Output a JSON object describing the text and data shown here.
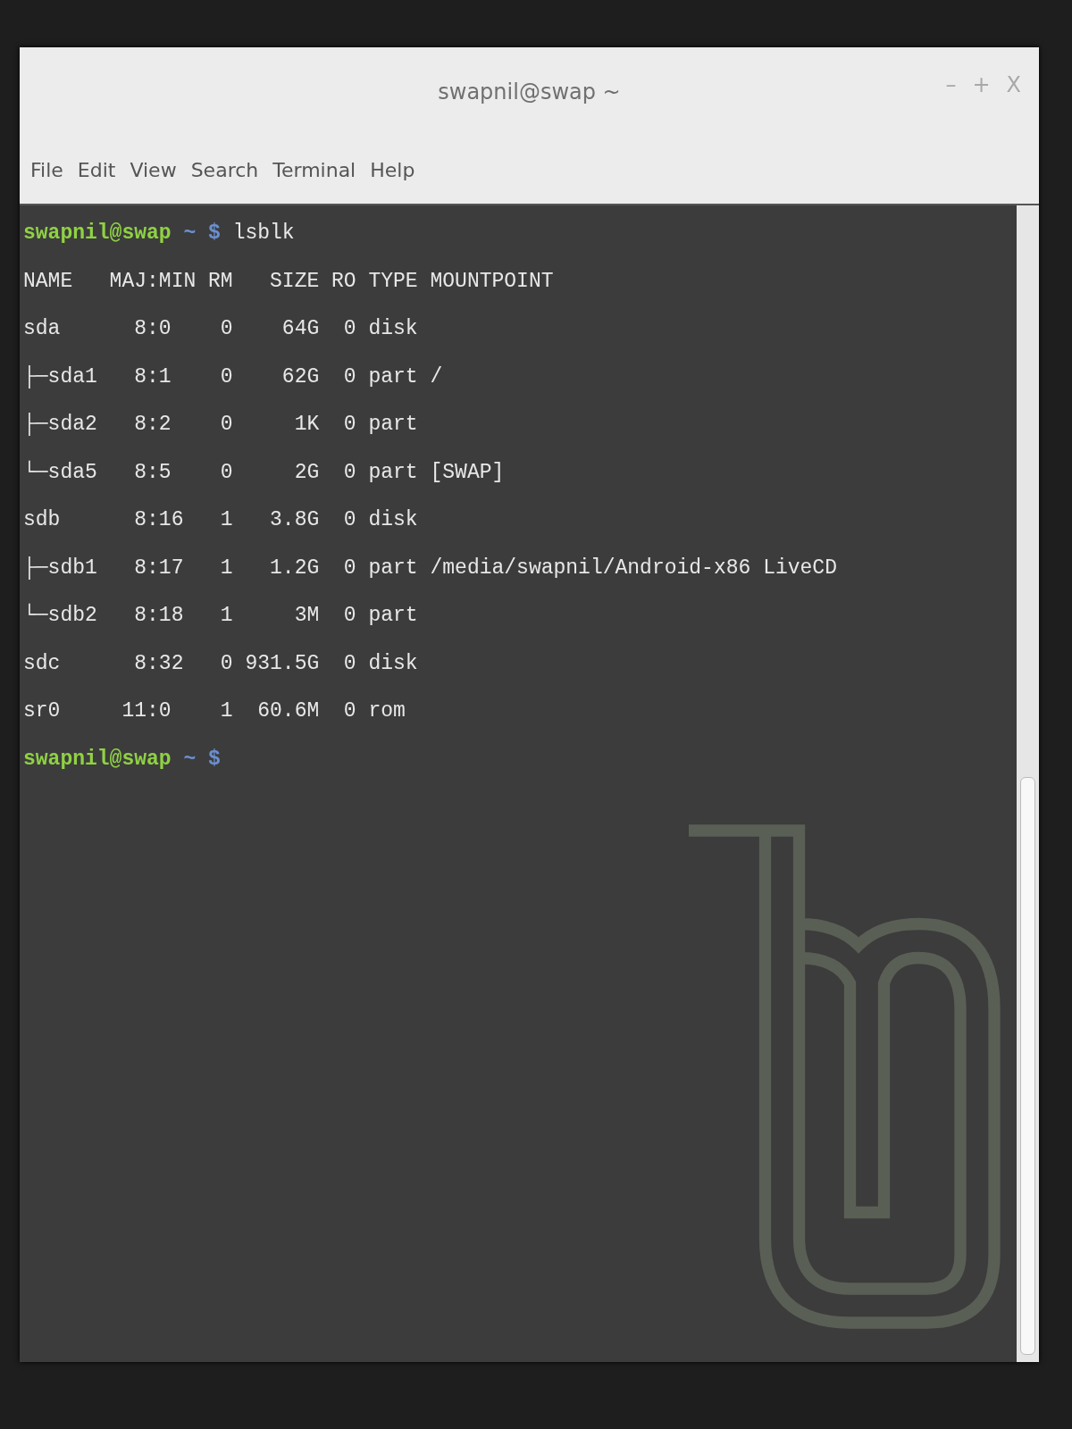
{
  "window": {
    "title": "swapnil@swap ~",
    "controls": [
      "–",
      "+",
      "X"
    ]
  },
  "menu": [
    "File",
    "Edit",
    "View",
    "Search",
    "Terminal",
    "Help"
  ],
  "terminal": {
    "lines": [
      {
        "kind": "prompt",
        "user_host": "swapnil@swap",
        "path": "~",
        "symbol": "$",
        "command": "lsblk"
      },
      {
        "kind": "output",
        "text": "NAME   MAJ:MIN RM   SIZE RO TYPE MOUNTPOINT"
      },
      {
        "kind": "output",
        "text": "sda      8:0    0    64G  0 disk"
      },
      {
        "kind": "output",
        "text": "├─sda1   8:1    0    62G  0 part /"
      },
      {
        "kind": "output",
        "text": "├─sda2   8:2    0     1K  0 part"
      },
      {
        "kind": "output",
        "text": "└─sda5   8:5    0     2G  0 part [SWAP]"
      },
      {
        "kind": "output",
        "text": "sdb      8:16   1   3.8G  0 disk"
      },
      {
        "kind": "output",
        "text": "├─sdb1   8:17   1   1.2G  0 part /media/swapnil/Android-x86 LiveCD"
      },
      {
        "kind": "output",
        "text": "└─sdb2   8:18   1     3M  0 part"
      },
      {
        "kind": "output",
        "text": "sdc      8:32   0 931.5G  0 disk"
      },
      {
        "kind": "output",
        "text": "sr0     11:0    1  60.6M  0 rom"
      },
      {
        "kind": "prompt",
        "user_host": "swapnil@swap",
        "path": "~",
        "symbol": "$"
      }
    ]
  }
}
